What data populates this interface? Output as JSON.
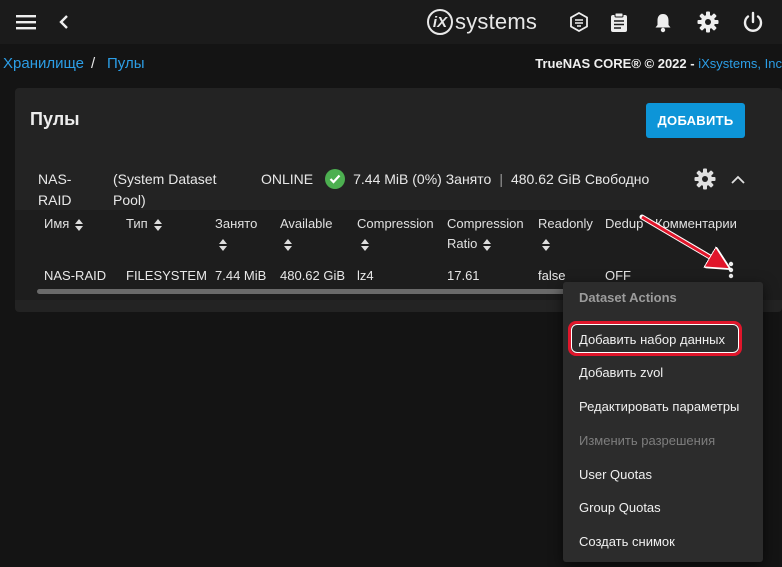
{
  "header": {
    "menu_icon": "hamburger-icon",
    "back_icon": "chevron-left-icon",
    "logo_mark": "iX",
    "logo_text": "systems",
    "icons": [
      "truecommand-icon",
      "clipboard-icon",
      "bell-icon",
      "gear-icon",
      "power-icon"
    ]
  },
  "breadcrumb": {
    "items": [
      "Хранилище",
      "Пулы"
    ],
    "separator": "/",
    "copyright_prefix": "TrueNAS CORE® © 2022 - ",
    "copyright_link": "iXsystems, Inc"
  },
  "pools": {
    "title": "Пулы",
    "add_label": "ДОБАВИТЬ",
    "pool": {
      "name": "NAS-RAID",
      "subtitle": "(System Dataset Pool)",
      "status": "ONLINE",
      "used": "7.44 MiB (0%) Занято",
      "free": "480.62 GiB Свободно"
    },
    "columns": [
      "Имя",
      "Тип",
      "Занято",
      "Available",
      "Compression",
      "Compression Ratio",
      "Readonly",
      "Dedup",
      "Комментарии"
    ],
    "row": {
      "name": "NAS-RAID",
      "type": "FILESYSTEM",
      "used": "7.44 MiB",
      "available": "480.62 GiB",
      "compression": "lz4",
      "ratio": "17.61",
      "readonly": "false",
      "dedup": "OFF"
    }
  },
  "menu": {
    "header": "Dataset Actions",
    "items": [
      "Добавить набор данных",
      "Добавить zvol",
      "Редактировать параметры",
      "Изменить разрешения",
      "User Quotas",
      "Group Quotas",
      "Создать снимок"
    ]
  },
  "colors": {
    "accent": "#0d95d8",
    "link": "#2c9ee6",
    "status_ok": "#4caf50",
    "annotation": "#e0162b"
  }
}
